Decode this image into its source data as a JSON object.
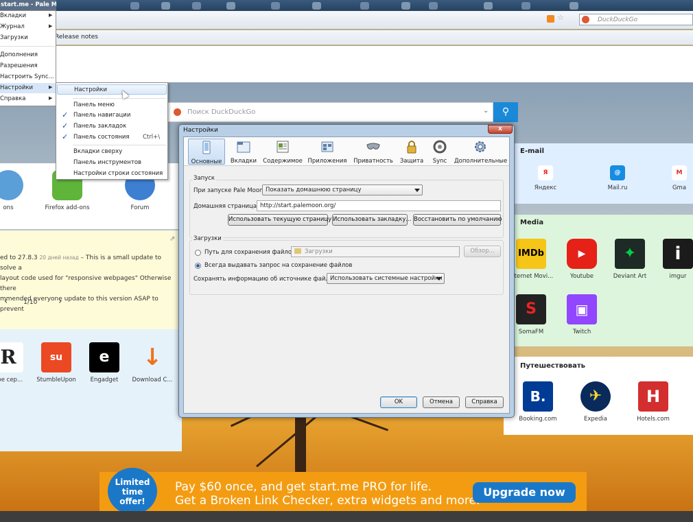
{
  "window": {
    "title": "start.me - Pale Moon",
    "websearch_placeholder": "DuckDuckGo",
    "bookmark_item": "Release notes"
  },
  "app_menu": {
    "items": [
      {
        "label": "Вкладки",
        "submenu": true
      },
      {
        "label": "Журнал",
        "submenu": true
      },
      {
        "label": "Загрузки",
        "submenu": false
      },
      {
        "label": "Дополнения",
        "submenu": false
      },
      {
        "label": "Разрешения",
        "submenu": false
      },
      {
        "label": "Настроить Sync...",
        "submenu": false
      },
      {
        "label": "Настройки",
        "submenu": true
      },
      {
        "label": "Справка",
        "submenu": true
      }
    ],
    "settings_submenu": {
      "settings": "Настройки",
      "menu_bar": "Панель меню",
      "nav_bar": "Панель навигации",
      "bookmarks_bar": "Панель закладок",
      "status_bar": "Панель состояния",
      "status_shortcut": "Ctrl+\\",
      "tabs_on_top": "Вкладки сверху",
      "toolbar_panel": "Панель инструментов",
      "status_bar_settings": "Настройки строки состояния"
    }
  },
  "startme": {
    "search_placeholder": "Поиск DuckDuckGo",
    "panel_left_1": {
      "tiles": [
        {
          "label": "ons",
          "icon": "globe-icon"
        },
        {
          "label": "Firefox add-ons",
          "icon": "puzzle-icon"
        },
        {
          "label": "Forum",
          "icon": "globe-icon"
        }
      ]
    },
    "news": {
      "lead": "ed to 27.8.3",
      "age": "20 дней назад",
      "line1": " – This is a small update to solve a",
      "line2": " layout code used for \"responsive webpages\" Otherwise there",
      "line3": "mmended everyone update to this version ASAP to prevent",
      "pager": "1/10",
      "prev": "‹",
      "next": "›"
    },
    "panel_left_2": {
      "tiles": [
        {
          "label": "ное сер...",
          "glyph": "R"
        },
        {
          "label": "StumbleUpon",
          "glyph": "su"
        },
        {
          "label": "Engadget",
          "glyph": "e"
        },
        {
          "label": "Download C...",
          "glyph": "↓"
        }
      ]
    },
    "email": {
      "title": "E-mail",
      "tiles": [
        {
          "label": "Яндекс",
          "glyph": "Я"
        },
        {
          "label": "Mail.ru",
          "glyph": "@"
        },
        {
          "label": "Gma",
          "glyph": "M"
        }
      ]
    },
    "media": {
      "title": "Media",
      "tiles": [
        {
          "label": "Internet Movi...",
          "glyph": "IMDb"
        },
        {
          "label": "Youtube",
          "glyph": "▶"
        },
        {
          "label": "Deviant Art",
          "glyph": "✦"
        },
        {
          "label": "imgur",
          "glyph": "i"
        },
        {
          "label": "SomaFM",
          "glyph": "S"
        },
        {
          "label": "Twitch",
          "glyph": "▣"
        }
      ]
    },
    "travel": {
      "title": "Путешествовать",
      "tiles": [
        {
          "label": "Booking.com",
          "glyph": "B."
        },
        {
          "label": "Expedia",
          "glyph": "✈"
        },
        {
          "label": "Hotels.com",
          "glyph": "H"
        }
      ]
    },
    "banner": {
      "badge": [
        "Limited",
        "time",
        "offer!"
      ],
      "line1": "Pay $60 once, and get start.me PRO for life.",
      "line2": "Get a Broken Link Checker, extra widgets and more.",
      "cta": "Upgrade now"
    }
  },
  "dialog": {
    "title": "Настройки",
    "close": "x",
    "panes": [
      {
        "label": "Основные",
        "selected": true,
        "icon": "general-icon"
      },
      {
        "label": "Вкладки",
        "selected": false,
        "icon": "tabs-icon"
      },
      {
        "label": "Содержимое",
        "selected": false,
        "icon": "content-icon"
      },
      {
        "label": "Приложения",
        "selected": false,
        "icon": "applications-icon"
      },
      {
        "label": "Приватность",
        "selected": false,
        "icon": "privacy-mask-icon"
      },
      {
        "label": "Защита",
        "selected": false,
        "icon": "lock-icon"
      },
      {
        "label": "Sync",
        "selected": false,
        "icon": "sync-icon"
      },
      {
        "label": "Дополнительные",
        "selected": false,
        "icon": "gear-icon"
      }
    ],
    "startup": {
      "group": "Запуск",
      "when_starts_label": "При запуске Pale Moon:",
      "when_starts_value": "Показать домашнюю страницу",
      "home_label": "Домашняя страница:",
      "home_value": "http://start.palemoon.org/",
      "btn_current": "Использовать текущую страницу",
      "btn_bookmark": "Использовать закладку...",
      "btn_default": "Восстановить по умолчанию"
    },
    "downloads": {
      "group": "Загрузки",
      "save_to_label": "Путь для сохранения файлов",
      "save_to_value": "Загрузки",
      "browse": "Обзор...",
      "always_ask": "Всегда выдавать запрос на сохранение файлов",
      "source_label": "Сохранять информацию об источнике файла:",
      "source_value": "Использовать системные настройки"
    },
    "buttons": {
      "ok": "OK",
      "cancel": "Отмена",
      "help": "Справка"
    }
  },
  "colors": {
    "accent": "#1a8ad8",
    "banner": "#f39c12",
    "titlebar": "#5a6e86"
  }
}
